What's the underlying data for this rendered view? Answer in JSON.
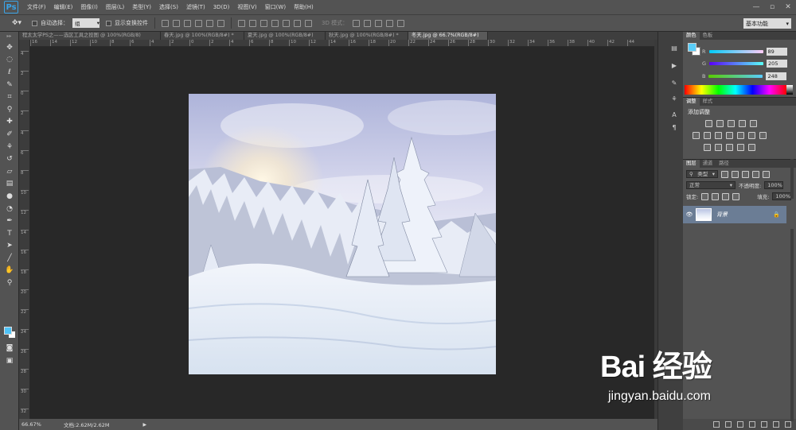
{
  "app": {
    "logo": "Ps"
  },
  "menu": [
    "文件(F)",
    "编辑(E)",
    "图像(I)",
    "图层(L)",
    "类型(Y)",
    "选择(S)",
    "滤镜(T)",
    "3D(D)",
    "视图(V)",
    "窗口(W)",
    "帮助(H)"
  ],
  "window_controls": [
    "minimize-icon",
    "maximize-icon",
    "close-icon"
  ],
  "options": {
    "auto_select_label": "自动选择：",
    "auto_select_value": "组",
    "show_transform_label": "显示变换控件",
    "threed_mode_label": "3D 模式：",
    "workspace": "基本功能"
  },
  "tabs": [
    {
      "label": "程太太学PS之——选区工具之投图 @ 100%(RGB/8)",
      "active": false
    },
    {
      "label": "春天.jpg @ 100%(RGB/8#) *",
      "active": false
    },
    {
      "label": "夏天.jpg @ 100%(RGB/8#)",
      "active": false
    },
    {
      "label": "秋天.jpg @ 100%(RGB/8#) *",
      "active": false
    },
    {
      "label": "冬天.jpg @ 66.7%(RGB/8#)",
      "active": true
    }
  ],
  "ruler_h": [
    "16",
    "14",
    "12",
    "10",
    "8",
    "6",
    "4",
    "2",
    "0",
    "2",
    "4",
    "6",
    "8",
    "10",
    "12",
    "14",
    "16",
    "18",
    "20",
    "22",
    "24",
    "26",
    "28",
    "30",
    "32",
    "34",
    "36",
    "38",
    "40",
    "42",
    "44"
  ],
  "ruler_v": [
    "4",
    "2",
    "0",
    "2",
    "4",
    "6",
    "8",
    "10",
    "12",
    "14",
    "16",
    "18",
    "20",
    "22",
    "24",
    "26",
    "28",
    "30",
    "32"
  ],
  "status": {
    "zoom": "66.67%",
    "doc": "文档:2.62M/2.62M"
  },
  "color_panel": {
    "tabs": [
      "颜色",
      "色板"
    ],
    "foreground": "#59cdf8",
    "channels": [
      {
        "name": "R",
        "value": "89"
      },
      {
        "name": "G",
        "value": "205"
      },
      {
        "name": "B",
        "value": "248"
      }
    ]
  },
  "adjust_panel": {
    "tabs": [
      "调整",
      "样式"
    ],
    "title": "添加调整"
  },
  "layers_panel": {
    "tabs": [
      "图层",
      "通道",
      "路径"
    ],
    "kind": "类型",
    "blend_mode": "正常",
    "opacity_label": "不透明度:",
    "opacity_value": "100%",
    "lock_label": "锁定:",
    "fill_label": "填充:",
    "fill_value": "100%",
    "layer_name": "背景"
  },
  "watermark": {
    "main": "Bai 经验",
    "sub": "jingyan.baidu.com"
  }
}
